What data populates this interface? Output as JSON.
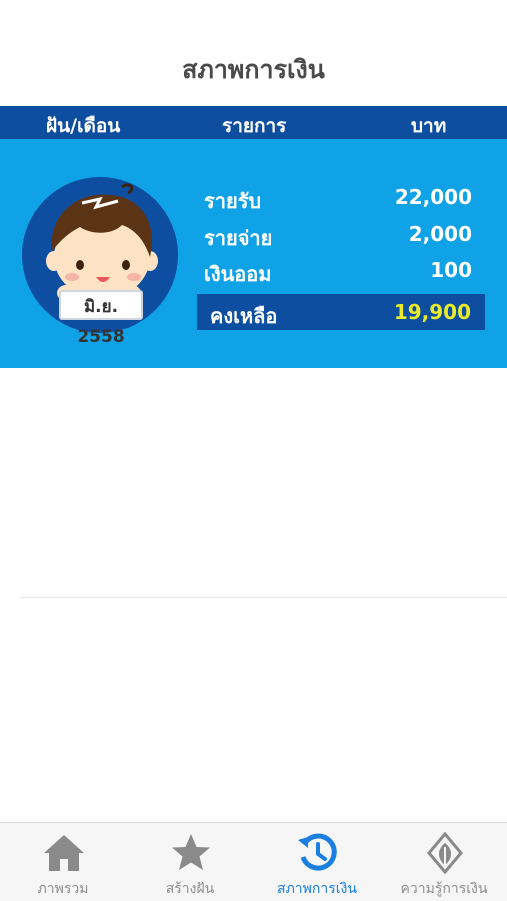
{
  "header": {
    "title": "สภาพการเงิน"
  },
  "columns": {
    "dream_month": "ฝัน/เดือน",
    "item": "รายการ",
    "baht": "บาท"
  },
  "summary": {
    "month_label": "มิ.ย. 2558",
    "rows": [
      {
        "label": "รายรับ",
        "value": "22,000"
      },
      {
        "label": "รายจ่าย",
        "value": "2,000"
      },
      {
        "label": "เงินออม",
        "value": "100"
      }
    ],
    "balance": {
      "label": "คงเหลือ",
      "value": "19,900"
    }
  },
  "tabs": [
    {
      "label": "ภาพรวม",
      "icon": "home-icon"
    },
    {
      "label": "สร้างฝัน",
      "icon": "star-icon"
    },
    {
      "label": "สภาพการเงิน",
      "icon": "history-icon",
      "active": true
    },
    {
      "label": "ความรู้การเงิน",
      "icon": "leaf-knowledge-icon"
    }
  ],
  "colors": {
    "navy": "#0d4ea0",
    "sky": "#0fa2e6",
    "balance_value": "#e8ea2a",
    "active_tab": "#1a7fe0"
  }
}
